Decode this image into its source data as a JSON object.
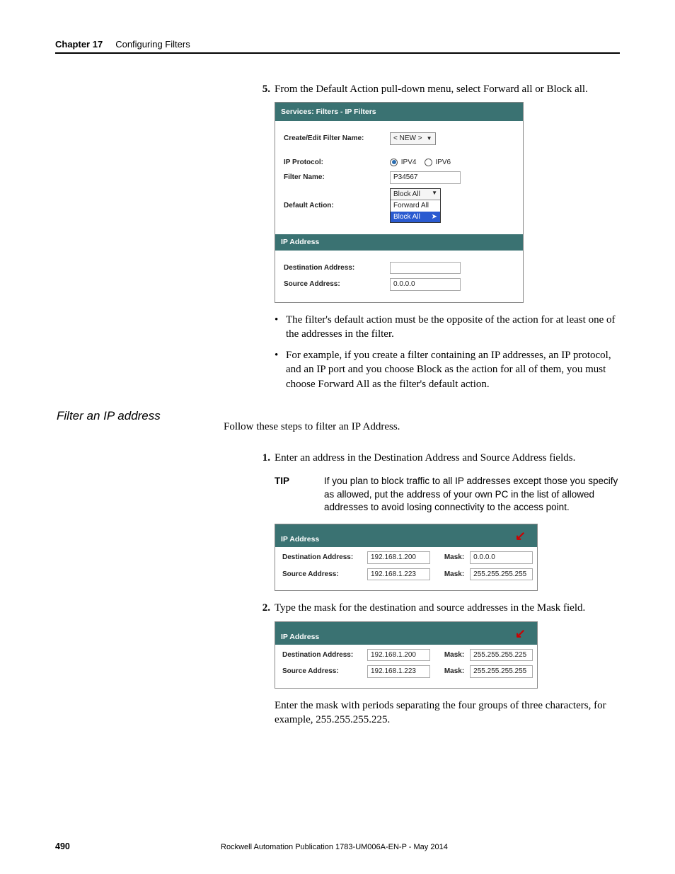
{
  "header": {
    "chapter_label": "Chapter 17",
    "chapter_title": "Configuring Filters"
  },
  "step5": {
    "num": "5.",
    "text": "From the Default Action pull-down menu, select Forward all or Block all."
  },
  "panel1": {
    "title": "Services: Filters - IP Filters",
    "rows": {
      "create_edit_label": "Create/Edit Filter Name:",
      "create_edit_value": "< NEW >",
      "ip_protocol_label": "IP Protocol:",
      "ipv4": "IPV4",
      "ipv6": "IPV6",
      "filter_name_label": "Filter Name:",
      "filter_name_value": "P34567",
      "default_action_label": "Default Action:",
      "default_action_top": "Block All",
      "dropdown_items": {
        "0": "Forward All",
        "1": "Block All"
      }
    },
    "section": "IP Address",
    "dest_label": "Destination Address:",
    "src_label": "Source Address:",
    "src_value": "0.0.0.0"
  },
  "bullets": {
    "0": "The filter's default action must be the opposite of the action for at least one of the addresses in the filter.",
    "1": "For example, if you create a filter containing an IP addresses, an IP protocol, and an IP port and you choose Block as the action for all of them, you must choose Forward All as the filter's default action."
  },
  "subheading": "Filter an IP address",
  "intro": "Follow these steps to filter an IP Address.",
  "step1": {
    "num": "1.",
    "text": "Enter an address in the Destination Address and Source Address fields."
  },
  "tip": {
    "label": "TIP",
    "text": "If you plan to block traffic to all IP addresses except those you specify as allowed, put the address of your own PC in the list of allowed addresses to avoid losing connectivity to the access point."
  },
  "panel2": {
    "section": "IP Address",
    "dest_label": "Destination Address:",
    "dest_value": "192.168.1.200",
    "src_label": "Source Address:",
    "src_value": "192.168.1.223",
    "mask_label": "Mask:",
    "dest_mask": "0.0.0.0",
    "src_mask": "255.255.255.255"
  },
  "step2": {
    "num": "2.",
    "text": "Type the mask for the destination and source addresses in the Mask field."
  },
  "panel3": {
    "section": "IP Address",
    "dest_label": "Destination Address:",
    "dest_value": "192.168.1.200",
    "src_label": "Source Address:",
    "src_value": "192.168.1.223",
    "mask_label": "Mask:",
    "dest_mask": "255.255.255.225",
    "src_mask": "255.255.255.255"
  },
  "followup": "Enter the mask with periods separating the four groups of three characters, for example, 255.255.255.225.",
  "footer": {
    "page": "490",
    "pub": "Rockwell Automation Publication 1783-UM006A-EN-P - May 2014"
  }
}
